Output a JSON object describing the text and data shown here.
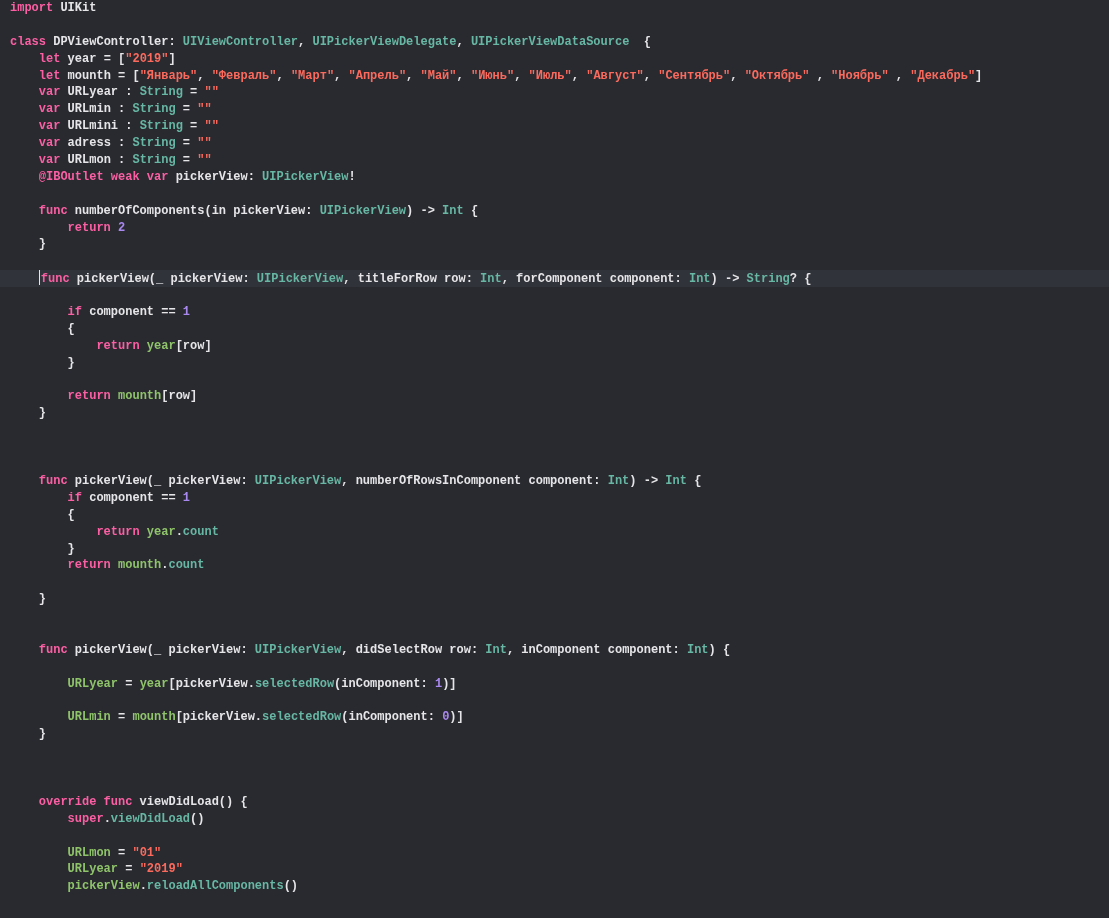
{
  "editor": {
    "lines": [
      {
        "kind": "code",
        "current": false,
        "tokens": [
          {
            "kind": "keyword",
            "text": "import"
          },
          {
            "kind": "plain",
            "text": " UIKit"
          }
        ]
      },
      {
        "kind": "blank",
        "current": false
      },
      {
        "kind": "code",
        "current": false,
        "tokens": [
          {
            "kind": "keyword",
            "text": "class"
          },
          {
            "kind": "plain",
            "text": " DPViewController: "
          },
          {
            "kind": "type",
            "text": "UIViewController"
          },
          {
            "kind": "plain",
            "text": ", "
          },
          {
            "kind": "type",
            "text": "UIPickerViewDelegate"
          },
          {
            "kind": "plain",
            "text": ", "
          },
          {
            "kind": "type",
            "text": "UIPickerViewDataSource"
          },
          {
            "kind": "plain",
            "text": "  {"
          }
        ]
      },
      {
        "kind": "code",
        "current": false,
        "tokens": [
          {
            "kind": "keyword",
            "text": "    let"
          },
          {
            "kind": "plain",
            "text": " year = ["
          },
          {
            "kind": "string",
            "text": "\"2019\""
          },
          {
            "kind": "plain",
            "text": "]"
          }
        ]
      },
      {
        "kind": "code",
        "current": false,
        "tokens": [
          {
            "kind": "keyword",
            "text": "    let"
          },
          {
            "kind": "plain",
            "text": " mounth = ["
          },
          {
            "kind": "string",
            "text": "\"Январь\""
          },
          {
            "kind": "plain",
            "text": ", "
          },
          {
            "kind": "string",
            "text": "\"Февраль\""
          },
          {
            "kind": "plain",
            "text": ", "
          },
          {
            "kind": "string",
            "text": "\"Март\""
          },
          {
            "kind": "plain",
            "text": ", "
          },
          {
            "kind": "string",
            "text": "\"Апрель\""
          },
          {
            "kind": "plain",
            "text": ", "
          },
          {
            "kind": "string",
            "text": "\"Май\""
          },
          {
            "kind": "plain",
            "text": ", "
          },
          {
            "kind": "string",
            "text": "\"Июнь\""
          },
          {
            "kind": "plain",
            "text": ", "
          },
          {
            "kind": "string",
            "text": "\"Июль\""
          },
          {
            "kind": "plain",
            "text": ", "
          },
          {
            "kind": "string",
            "text": "\"Август\""
          },
          {
            "kind": "plain",
            "text": ", "
          },
          {
            "kind": "string",
            "text": "\"Сентябрь\""
          },
          {
            "kind": "plain",
            "text": ", "
          },
          {
            "kind": "string",
            "text": "\"Октябрь\""
          },
          {
            "kind": "plain",
            "text": " , "
          },
          {
            "kind": "string",
            "text": "\"Ноябрь\""
          },
          {
            "kind": "plain",
            "text": " , "
          },
          {
            "kind": "string",
            "text": "\"Декабрь\""
          },
          {
            "kind": "plain",
            "text": "]"
          }
        ]
      },
      {
        "kind": "code",
        "current": false,
        "tokens": [
          {
            "kind": "keyword",
            "text": "    var"
          },
          {
            "kind": "plain",
            "text": " URLyear : "
          },
          {
            "kind": "type",
            "text": "String"
          },
          {
            "kind": "plain",
            "text": " = "
          },
          {
            "kind": "string",
            "text": "\"\""
          }
        ]
      },
      {
        "kind": "code",
        "current": false,
        "tokens": [
          {
            "kind": "keyword",
            "text": "    var"
          },
          {
            "kind": "plain",
            "text": " URLmin : "
          },
          {
            "kind": "type",
            "text": "String"
          },
          {
            "kind": "plain",
            "text": " = "
          },
          {
            "kind": "string",
            "text": "\"\""
          }
        ]
      },
      {
        "kind": "code",
        "current": false,
        "tokens": [
          {
            "kind": "keyword",
            "text": "    var"
          },
          {
            "kind": "plain",
            "text": " URLmini : "
          },
          {
            "kind": "type",
            "text": "String"
          },
          {
            "kind": "plain",
            "text": " = "
          },
          {
            "kind": "string",
            "text": "\"\""
          }
        ]
      },
      {
        "kind": "code",
        "current": false,
        "tokens": [
          {
            "kind": "keyword",
            "text": "    var"
          },
          {
            "kind": "plain",
            "text": " adress : "
          },
          {
            "kind": "type",
            "text": "String"
          },
          {
            "kind": "plain",
            "text": " = "
          },
          {
            "kind": "string",
            "text": "\"\""
          }
        ]
      },
      {
        "kind": "code",
        "current": false,
        "tokens": [
          {
            "kind": "keyword",
            "text": "    var"
          },
          {
            "kind": "plain",
            "text": " URLmon : "
          },
          {
            "kind": "type",
            "text": "String"
          },
          {
            "kind": "plain",
            "text": " = "
          },
          {
            "kind": "string",
            "text": "\"\""
          }
        ]
      },
      {
        "kind": "code",
        "current": false,
        "tokens": [
          {
            "kind": "keyword",
            "text": "    @IBOutlet weak var"
          },
          {
            "kind": "plain",
            "text": " pickerView: "
          },
          {
            "kind": "type",
            "text": "UIPickerView"
          },
          {
            "kind": "plain",
            "text": "!"
          }
        ]
      },
      {
        "kind": "blank",
        "current": false
      },
      {
        "kind": "code",
        "current": false,
        "tokens": [
          {
            "kind": "keyword",
            "text": "    func"
          },
          {
            "kind": "plain",
            "text": " numberOfComponents(in pickerView: "
          },
          {
            "kind": "type",
            "text": "UIPickerView"
          },
          {
            "kind": "plain",
            "text": ") -> "
          },
          {
            "kind": "type",
            "text": "Int"
          },
          {
            "kind": "plain",
            "text": " {"
          }
        ]
      },
      {
        "kind": "code",
        "current": false,
        "tokens": [
          {
            "kind": "keyword",
            "text": "        return "
          },
          {
            "kind": "number",
            "text": "2"
          }
        ]
      },
      {
        "kind": "code",
        "current": false,
        "tokens": [
          {
            "kind": "plain",
            "text": "    }"
          }
        ]
      },
      {
        "kind": "blank",
        "current": false
      },
      {
        "kind": "code",
        "current": true,
        "tokens": [
          {
            "kind": "keyword",
            "text": "func"
          },
          {
            "kind": "plain",
            "text": " pickerView(_ pickerView: "
          },
          {
            "kind": "type",
            "text": "UIPickerView"
          },
          {
            "kind": "plain",
            "text": ", titleForRow row: "
          },
          {
            "kind": "type",
            "text": "Int"
          },
          {
            "kind": "plain",
            "text": ", forComponent component: "
          },
          {
            "kind": "type",
            "text": "Int"
          },
          {
            "kind": "plain",
            "text": ") -> "
          },
          {
            "kind": "type",
            "text": "String"
          },
          {
            "kind": "plain",
            "text": "? {"
          }
        ]
      },
      {
        "kind": "blank",
        "current": false
      },
      {
        "kind": "code",
        "current": false,
        "tokens": [
          {
            "kind": "keyword",
            "text": "        if"
          },
          {
            "kind": "plain",
            "text": " component == "
          },
          {
            "kind": "number",
            "text": "1"
          }
        ]
      },
      {
        "kind": "code",
        "current": false,
        "tokens": [
          {
            "kind": "plain",
            "text": "        {"
          }
        ]
      },
      {
        "kind": "code",
        "current": false,
        "tokens": [
          {
            "kind": "keyword",
            "text": "            return "
          },
          {
            "kind": "ident",
            "text": "year"
          },
          {
            "kind": "plain",
            "text": "[row]"
          }
        ]
      },
      {
        "kind": "code",
        "current": false,
        "tokens": [
          {
            "kind": "plain",
            "text": "        }"
          }
        ]
      },
      {
        "kind": "blank",
        "current": false
      },
      {
        "kind": "code",
        "current": false,
        "tokens": [
          {
            "kind": "keyword",
            "text": "        return "
          },
          {
            "kind": "ident",
            "text": "mounth"
          },
          {
            "kind": "plain",
            "text": "[row]"
          }
        ]
      },
      {
        "kind": "code",
        "current": false,
        "tokens": [
          {
            "kind": "plain",
            "text": "    }"
          }
        ]
      },
      {
        "kind": "blank",
        "current": false
      },
      {
        "kind": "blank",
        "current": false
      },
      {
        "kind": "blank",
        "current": false
      },
      {
        "kind": "code",
        "current": false,
        "tokens": [
          {
            "kind": "keyword",
            "text": "    func"
          },
          {
            "kind": "plain",
            "text": " pickerView(_ pickerView: "
          },
          {
            "kind": "type",
            "text": "UIPickerView"
          },
          {
            "kind": "plain",
            "text": ", numberOfRowsInComponent component: "
          },
          {
            "kind": "type",
            "text": "Int"
          },
          {
            "kind": "plain",
            "text": ") -> "
          },
          {
            "kind": "type",
            "text": "Int"
          },
          {
            "kind": "plain",
            "text": " {"
          }
        ]
      },
      {
        "kind": "code",
        "current": false,
        "tokens": [
          {
            "kind": "keyword",
            "text": "        if"
          },
          {
            "kind": "plain",
            "text": " component == "
          },
          {
            "kind": "number",
            "text": "1"
          }
        ]
      },
      {
        "kind": "code",
        "current": false,
        "tokens": [
          {
            "kind": "plain",
            "text": "        {"
          }
        ]
      },
      {
        "kind": "code",
        "current": false,
        "tokens": [
          {
            "kind": "keyword",
            "text": "            return "
          },
          {
            "kind": "ident",
            "text": "year"
          },
          {
            "kind": "plain",
            "text": "."
          },
          {
            "kind": "type",
            "text": "count"
          }
        ]
      },
      {
        "kind": "code",
        "current": false,
        "tokens": [
          {
            "kind": "plain",
            "text": "        }"
          }
        ]
      },
      {
        "kind": "code",
        "current": false,
        "tokens": [
          {
            "kind": "keyword",
            "text": "        return "
          },
          {
            "kind": "ident",
            "text": "mounth"
          },
          {
            "kind": "plain",
            "text": "."
          },
          {
            "kind": "type",
            "text": "count"
          }
        ]
      },
      {
        "kind": "blank",
        "current": false
      },
      {
        "kind": "code",
        "current": false,
        "tokens": [
          {
            "kind": "plain",
            "text": "    }"
          }
        ]
      },
      {
        "kind": "blank",
        "current": false
      },
      {
        "kind": "blank",
        "current": false
      },
      {
        "kind": "code",
        "current": false,
        "tokens": [
          {
            "kind": "keyword",
            "text": "    func"
          },
          {
            "kind": "plain",
            "text": " pickerView(_ pickerView: "
          },
          {
            "kind": "type",
            "text": "UIPickerView"
          },
          {
            "kind": "plain",
            "text": ", didSelectRow row: "
          },
          {
            "kind": "type",
            "text": "Int"
          },
          {
            "kind": "plain",
            "text": ", inComponent component: "
          },
          {
            "kind": "type",
            "text": "Int"
          },
          {
            "kind": "plain",
            "text": ") {"
          }
        ]
      },
      {
        "kind": "blank",
        "current": false
      },
      {
        "kind": "code",
        "current": false,
        "tokens": [
          {
            "kind": "ident",
            "text": "        URLyear"
          },
          {
            "kind": "plain",
            "text": " = "
          },
          {
            "kind": "ident",
            "text": "year"
          },
          {
            "kind": "plain",
            "text": "[pickerView."
          },
          {
            "kind": "type",
            "text": "selectedRow"
          },
          {
            "kind": "plain",
            "text": "(inComponent: "
          },
          {
            "kind": "number",
            "text": "1"
          },
          {
            "kind": "plain",
            "text": ")]"
          }
        ]
      },
      {
        "kind": "blank",
        "current": false
      },
      {
        "kind": "code",
        "current": false,
        "tokens": [
          {
            "kind": "ident",
            "text": "        URLmin"
          },
          {
            "kind": "plain",
            "text": " = "
          },
          {
            "kind": "ident",
            "text": "mounth"
          },
          {
            "kind": "plain",
            "text": "[pickerView."
          },
          {
            "kind": "type",
            "text": "selectedRow"
          },
          {
            "kind": "plain",
            "text": "(inComponent: "
          },
          {
            "kind": "number",
            "text": "0"
          },
          {
            "kind": "plain",
            "text": ")]"
          }
        ]
      },
      {
        "kind": "code",
        "current": false,
        "tokens": [
          {
            "kind": "plain",
            "text": "    }"
          }
        ]
      },
      {
        "kind": "blank",
        "current": false
      },
      {
        "kind": "blank",
        "current": false
      },
      {
        "kind": "blank",
        "current": false
      },
      {
        "kind": "code",
        "current": false,
        "tokens": [
          {
            "kind": "keyword",
            "text": "    override func"
          },
          {
            "kind": "plain",
            "text": " viewDidLoad() {"
          }
        ]
      },
      {
        "kind": "code",
        "current": false,
        "tokens": [
          {
            "kind": "keyword",
            "text": "        super"
          },
          {
            "kind": "plain",
            "text": "."
          },
          {
            "kind": "type",
            "text": "viewDidLoad"
          },
          {
            "kind": "plain",
            "text": "()"
          }
        ]
      },
      {
        "kind": "blank",
        "current": false
      },
      {
        "kind": "code",
        "current": false,
        "tokens": [
          {
            "kind": "ident",
            "text": "        URLmon"
          },
          {
            "kind": "plain",
            "text": " = "
          },
          {
            "kind": "string",
            "text": "\"01\""
          }
        ]
      },
      {
        "kind": "code",
        "current": false,
        "tokens": [
          {
            "kind": "ident",
            "text": "        URLyear"
          },
          {
            "kind": "plain",
            "text": " = "
          },
          {
            "kind": "string",
            "text": "\"2019\""
          }
        ]
      },
      {
        "kind": "code",
        "current": false,
        "tokens": [
          {
            "kind": "ident",
            "text": "        pickerView"
          },
          {
            "kind": "plain",
            "text": "."
          },
          {
            "kind": "type",
            "text": "reloadAllComponents"
          },
          {
            "kind": "plain",
            "text": "()"
          }
        ]
      }
    ]
  }
}
